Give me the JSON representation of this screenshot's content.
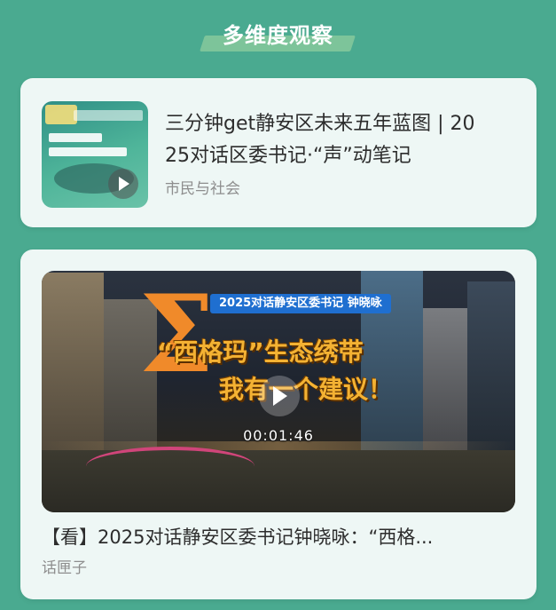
{
  "section": {
    "title": "多维度观察"
  },
  "articles": [
    {
      "title_line1": "三分钟get静安区未来五年蓝图 | 20",
      "title_line2": "25对话区委书记·“声”动笔记",
      "source": "市民与社会",
      "thumbnail_icon": "play-icon"
    },
    {
      "title": "【看】2025对话静安区委书记钟晓咏：“西格...",
      "source": "话匣子",
      "video": {
        "badge": "2025对话静安区委书记 钟晓咏",
        "headline1": "“西格玛”生态绣带",
        "headline2": "我有一个建议！",
        "duration": "00:01:46"
      }
    }
  ],
  "colors": {
    "background": "#4aaa90",
    "card": "#eef7f5",
    "title_text": "#2d2d2d",
    "source_text": "#8e8e8e",
    "banner": "#7dc49a"
  }
}
